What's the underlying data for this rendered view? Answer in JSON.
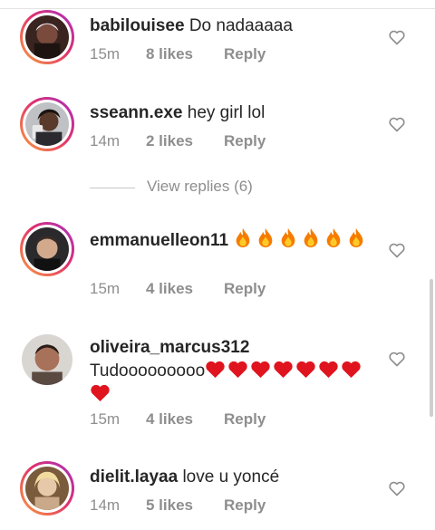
{
  "comments": [
    {
      "username": "babilouisee",
      "text": "Do nadaaaaa",
      "emojis": [],
      "emoji_kind": "",
      "time": "15m",
      "likes": "8 likes",
      "reply": "Reply"
    },
    {
      "username": "sseann.exe",
      "text": "hey girl lol",
      "emojis": [],
      "emoji_kind": "",
      "time": "14m",
      "likes": "2 likes",
      "reply": "Reply"
    },
    {
      "username": "emmanuelleon11",
      "text": "",
      "emojis": [
        "🔥",
        "🔥",
        "🔥",
        "🔥",
        "🔥",
        "🔥"
      ],
      "emoji_kind": "fire-emoji",
      "time": "15m",
      "likes": "4 likes",
      "reply": "Reply"
    },
    {
      "username": "oliveira_marcus312",
      "text": "Tudooooooooo",
      "emojis": [
        "❤️",
        "❤️",
        "❤️",
        "❤️",
        "❤️",
        "❤️",
        "❤️",
        "❤️"
      ],
      "emoji_kind": "red-heart-emoji",
      "time": "15m",
      "likes": "4 likes",
      "reply": "Reply"
    },
    {
      "username": "dielit.layaa",
      "text": "love u yoncé",
      "emojis": [],
      "emoji_kind": "",
      "time": "14m",
      "likes": "5 likes",
      "reply": "Reply"
    }
  ],
  "view_replies": "View replies (6)",
  "icons": {
    "like": "heart-outline-icon"
  },
  "colors": {
    "story_ring_start": "#f9a03f",
    "story_ring_mid": "#e1306c",
    "story_ring_end": "#a431c4",
    "secondary_text": "#8e8e8e"
  }
}
